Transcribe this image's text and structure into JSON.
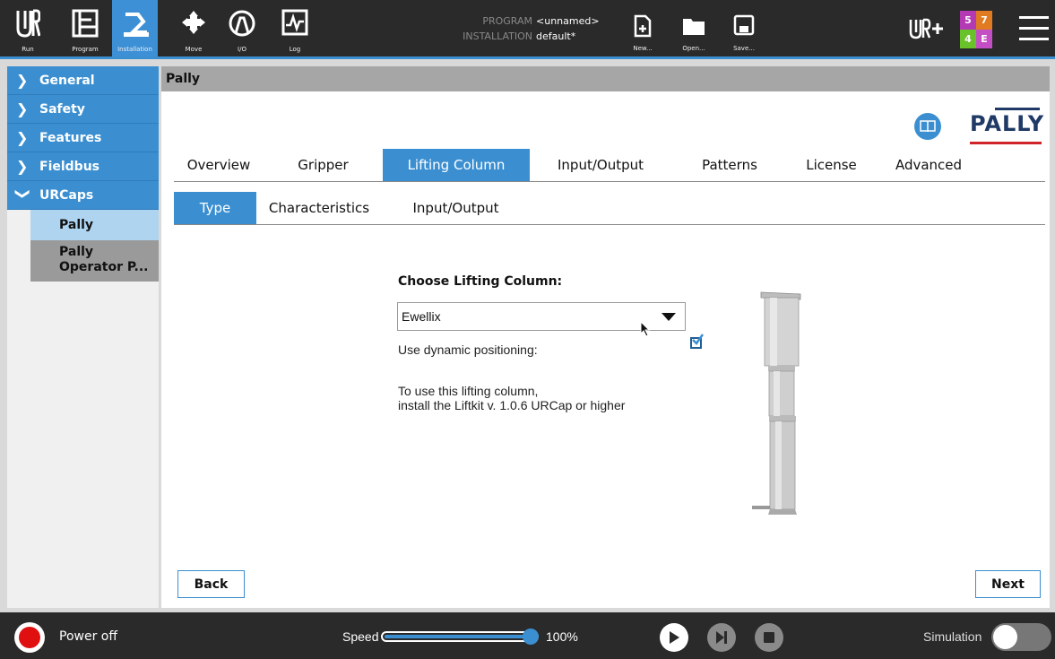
{
  "topbar": {
    "nav": [
      {
        "label": "Run",
        "icon": "ur-logo-icon"
      },
      {
        "label": "Program",
        "icon": "program-icon"
      },
      {
        "label": "Installation",
        "icon": "installation-icon"
      },
      {
        "label": "Move",
        "icon": "move-icon"
      },
      {
        "label": "I/O",
        "icon": "io-icon"
      },
      {
        "label": "Log",
        "icon": "log-icon"
      }
    ],
    "program_key": "PROGRAM",
    "program_value": "<unnamed>",
    "installation_key": "INSTALLATION",
    "installation_value": "default*",
    "file_buttons": [
      {
        "label": "New...",
        "icon": "new-file-icon"
      },
      {
        "label": "Open...",
        "icon": "open-folder-icon"
      },
      {
        "label": "Save...",
        "icon": "save-icon"
      }
    ],
    "badge": {
      "tl": "5",
      "tr": "7",
      "bl": "4",
      "br": "E"
    },
    "colors": {
      "accent": "#3b8fd1",
      "badge_tl": "#b43ab4",
      "badge_tr": "#e07b22",
      "badge_bl": "#6ac22a",
      "badge_br": "#c44fc4"
    }
  },
  "sidebar": {
    "items": [
      {
        "label": "General"
      },
      {
        "label": "Safety"
      },
      {
        "label": "Features"
      },
      {
        "label": "Fieldbus"
      },
      {
        "label": "URCaps"
      }
    ],
    "subitems": [
      {
        "label": "Pally"
      },
      {
        "label1": "Pally",
        "label2": "Operator P..."
      }
    ]
  },
  "main": {
    "title": "Pally",
    "logo_text": "PALLY",
    "tabs": [
      "Overview",
      "Gripper",
      "Lifting Column",
      "Input/Output",
      "Patterns",
      "License",
      "Advanced"
    ],
    "subtabs": [
      "Type",
      "Characteristics",
      "Input/Output"
    ],
    "choose_label": "Choose Lifting Column:",
    "dropdown_value": "Ewellix",
    "dynamic_label": "Use dynamic positioning:",
    "dynamic_checked": true,
    "hint_line1": "To use this lifting column,",
    "hint_line2": "install the Liftkit v. 1.0.6 URCap or higher",
    "back_label": "Back",
    "next_label": "Next"
  },
  "bottombar": {
    "power_label": "Power off",
    "speed_label": "Speed",
    "speed_value": "100%",
    "speed_fraction": 1.0,
    "simulation_label": "Simulation"
  }
}
